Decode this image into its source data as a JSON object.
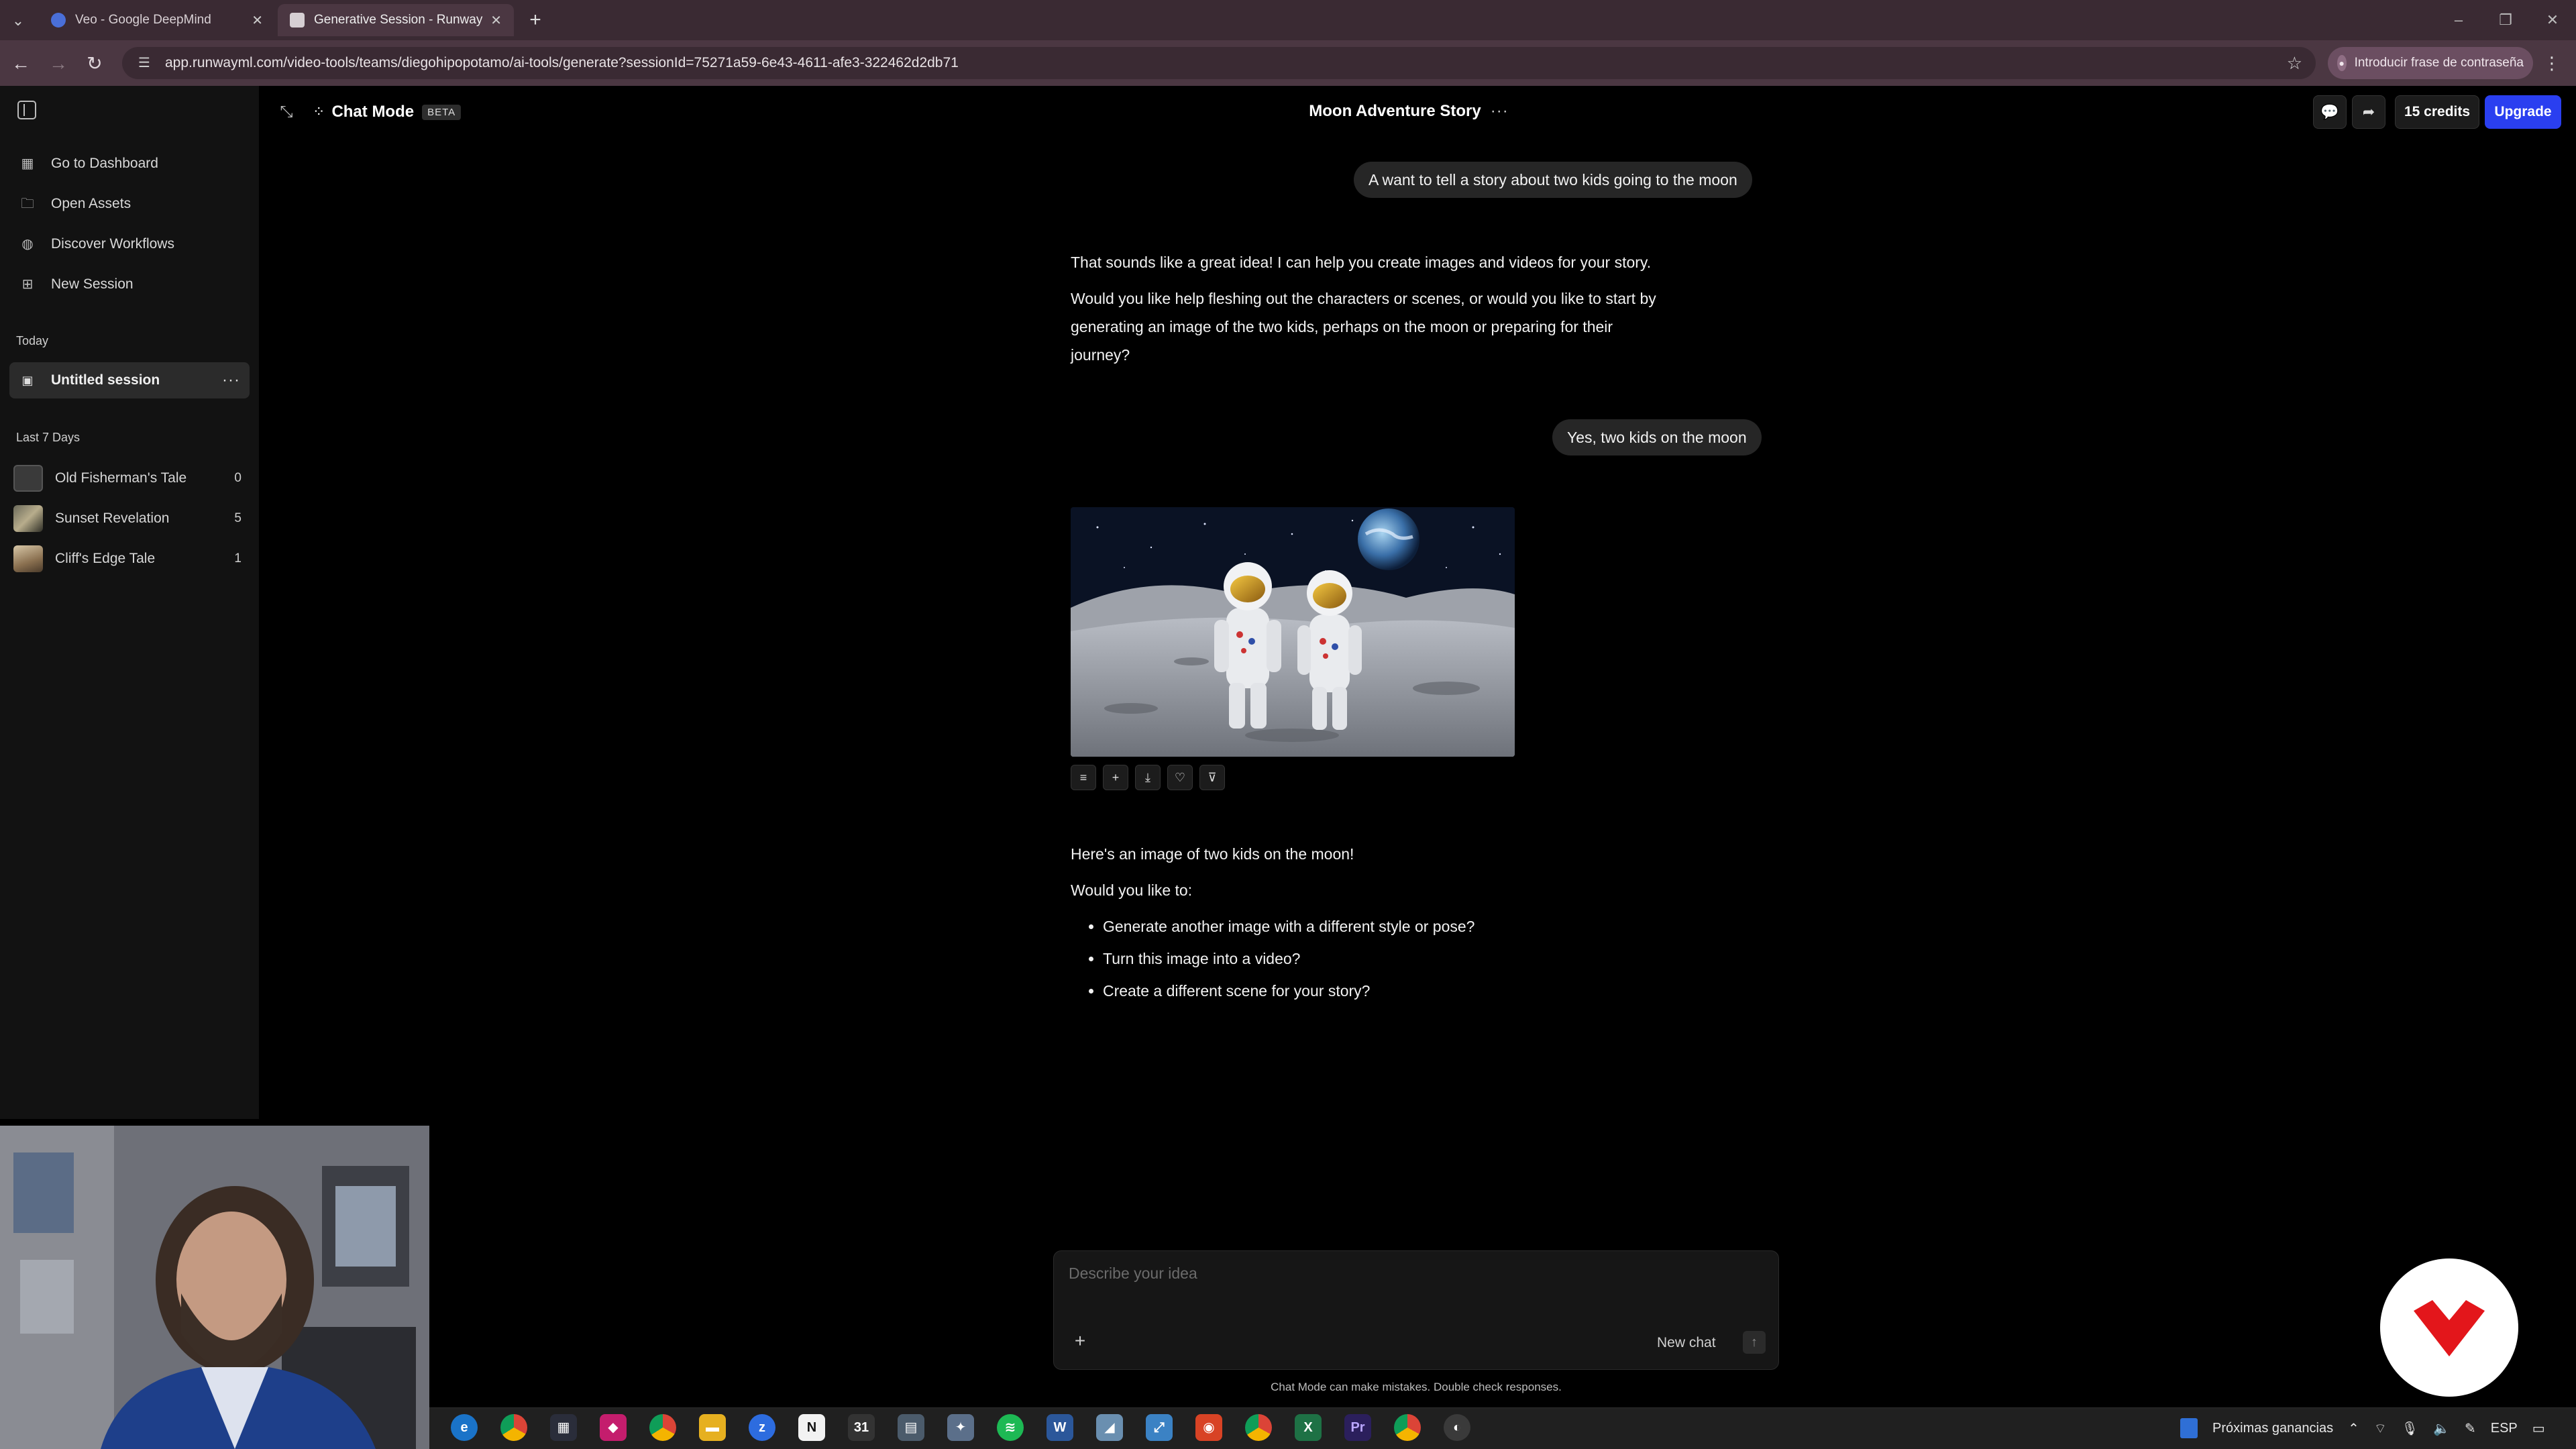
{
  "browser": {
    "tabs": [
      {
        "title": "Veo - Google DeepMind",
        "active": false
      },
      {
        "title": "Generative Session - Runway",
        "active": true
      }
    ],
    "url": "app.runwayml.com/video-tools/teams/diegohipopotamo/ai-tools/generate?sessionId=75271a59-6e43-4611-afe3-322462d2db71",
    "password_chip": "Introducir frase de contraseña"
  },
  "sidebar": {
    "nav": [
      {
        "label": "Go to Dashboard",
        "icon": "dashboard-icon"
      },
      {
        "label": "Open Assets",
        "icon": "folder-icon"
      },
      {
        "label": "Discover Workflows",
        "icon": "globe-icon"
      },
      {
        "label": "New Session",
        "icon": "plus-square-icon"
      }
    ],
    "today_heading": "Today",
    "active_session": "Untitled session",
    "last7_heading": "Last 7 Days",
    "history": [
      {
        "label": "Old Fisherman's Tale",
        "count": "0"
      },
      {
        "label": "Sunset Revelation",
        "count": "5"
      },
      {
        "label": "Cliff's Edge Tale",
        "count": "1"
      }
    ]
  },
  "header": {
    "mode": "Chat Mode",
    "badge": "BETA",
    "session_title": "Moon Adventure Story",
    "credits": "15 credits",
    "upgrade": "Upgrade"
  },
  "chat": {
    "user_msg_1": "A want to tell a story about two kids going to the moon",
    "ai_reply_1_p1": "That sounds like a great idea! I can help you create images and videos for your story.",
    "ai_reply_1_p2": "Would you like help fleshing out the characters or scenes, or would you like to start by generating an image of the two kids, perhaps on the moon or preparing for their journey?",
    "user_msg_2": "Yes, two kids on the moon",
    "ai_reply_2_line1": "Here's an image of two kids on the moon!",
    "ai_reply_2_line2": "Would you like to:",
    "ai_reply_2_options": [
      "Generate another image with a different style or pose?",
      "Turn this image into a video?",
      "Create a different scene for your story?"
    ]
  },
  "composer": {
    "placeholder": "Describe your idea",
    "new_chat": "New chat",
    "disclaimer": "Chat Mode can make mistakes. Double check responses."
  },
  "taskbar": {
    "news": "Próximas ganancias",
    "lang": "ESP"
  },
  "colors": {
    "accent": "#2a3ff0",
    "tab_strip": "#3a2a33",
    "toolbar": "#4b3742",
    "sidebar": "#121212",
    "brand_red": "#e3161b"
  }
}
